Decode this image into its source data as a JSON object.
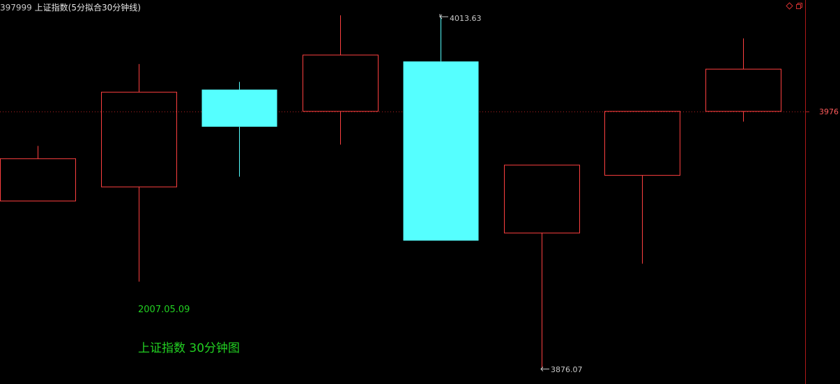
{
  "header": {
    "code": "397999",
    "title": "上证指数(5分拟合30分钟线)"
  },
  "window_controls": [
    {
      "icon": "diamond-icon"
    },
    {
      "icon": "restore-window-icon"
    }
  ],
  "colors": {
    "background": "#000000",
    "up": "#ff4040",
    "down": "#55ffff",
    "axis": "#c01818",
    "annotation": "#22d022",
    "reference_line": "#b02020"
  },
  "annotations": {
    "date": "2007.05.09",
    "caption": "上证指数 30分钟图"
  },
  "chart_data": {
    "type": "candlestick",
    "price_range": [
      3870,
      4020
    ],
    "reference_price": 3976,
    "reference_label": "3976",
    "extremes": {
      "high_label": "4013.63",
      "low_label": "3876.07"
    },
    "candles": [
      {
        "open": 3941.5,
        "close": 3958.0,
        "high": 3963.0,
        "low": null
      },
      {
        "open": 3947.0,
        "close": 3984.0,
        "high": 3995.0,
        "low": 3910.0
      },
      {
        "open": 3985.0,
        "close": 3970.5,
        "high": 3988.0,
        "low": 3951.0
      },
      {
        "open": 3976.5,
        "close": 3998.5,
        "high": 4014.0,
        "low": 3963.5
      },
      {
        "open": 3996.0,
        "close": 3926.0,
        "high": 4013.63,
        "low": 3926.0
      },
      {
        "open": 3929.0,
        "close": 3955.5,
        "high": 3955.5,
        "low": 3876.07
      },
      {
        "open": 3951.5,
        "close": 3976.5,
        "high": 3976.5,
        "low": 3917.0
      },
      {
        "open": 3976.5,
        "close": 3993.0,
        "high": 4005.0,
        "low": 3972.5
      }
    ]
  }
}
